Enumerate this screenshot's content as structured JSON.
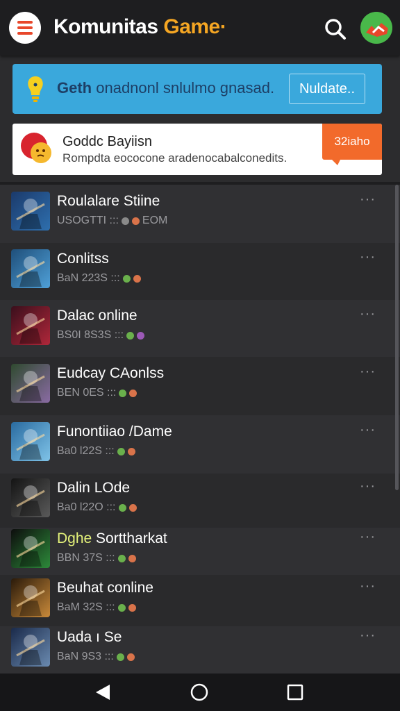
{
  "header": {
    "title_main": "Komunitas ",
    "title_accent": "Game·",
    "menu_icon": "hamburger-menu-icon",
    "search_icon": "search-icon",
    "avatar_icon": "user-avatar-icon"
  },
  "banner": {
    "text_bold": "Geth",
    "text_rest": " onadnonl snlulmo gnasad.",
    "button_label": "Nuldate..",
    "icon": "lightbulb-icon",
    "color": "#3aa8dc"
  },
  "notice": {
    "title": "Goddc Bayiisn",
    "subtitle": "Rompdta eococone aradenocabalconedits.",
    "tag_label": "32iaho",
    "icon": "emoji-face-icon",
    "tag_color": "#f26a2b"
  },
  "games": [
    {
      "name": "Roulalare Stiine",
      "meta": "USOGTTI ::: ",
      "meta_tail": " EOM",
      "dot1": "#8a8a8a",
      "dot2": "#d9734a",
      "thumb": [
        "#1b3a6b",
        "#2e6fae"
      ]
    },
    {
      "name": "Conlitss",
      "meta": "BaN 223S ::: ",
      "meta_tail": "",
      "dot1": "#6ab04c",
      "dot2": "#d9734a",
      "thumb": [
        "#1f4f7a",
        "#4fa0d8"
      ]
    },
    {
      "name": "Dalac online",
      "meta": "BS0I 8S3S ::: ",
      "meta_tail": "",
      "dot1": "#6ab04c",
      "dot2": "#9b59b6",
      "thumb": [
        "#3a0f1c",
        "#b0273a"
      ]
    },
    {
      "name": "Eudcay CAonlss",
      "meta": "BEN 0ES ::: ",
      "meta_tail": "",
      "dot1": "#6ab04c",
      "dot2": "#d9734a",
      "thumb": [
        "#2f4a2f",
        "#8a6ba3"
      ]
    },
    {
      "name": "Funontiiao /Dame",
      "meta": "Ba0 l22S ::: ",
      "meta_tail": "",
      "dot1": "#6ab04c",
      "dot2": "#d9734a",
      "thumb": [
        "#2a6ba0",
        "#7fc3e8"
      ]
    },
    {
      "name": "Dalin LOde",
      "meta": "Ba0 l22O ::: ",
      "meta_tail": "",
      "dot1": "#6ab04c",
      "dot2": "#d9734a",
      "thumb": [
        "#141414",
        "#5a5a5a"
      ]
    },
    {
      "name": "Dghe Sorttharkat",
      "meta": "BBN 37S ::: ",
      "meta_tail": "",
      "dot1": "#6ab04c",
      "dot2": "#d9734a",
      "thumb": [
        "#0d0d0d",
        "#2d8a3a"
      ],
      "accent": "#e4f27a"
    },
    {
      "name": "Beuhat conline",
      "meta": "BaM 32S ::: ",
      "meta_tail": "",
      "dot1": "#6ab04c",
      "dot2": "#d9734a",
      "thumb": [
        "#2a1a0a",
        "#c98a3a"
      ]
    },
    {
      "name": "Uada ı Se",
      "meta": "BaN 9S3 ::: ",
      "meta_tail": "",
      "dot1": "#6ab04c",
      "dot2": "#d9734a",
      "thumb": [
        "#1a2a4a",
        "#6a8ab0"
      ]
    }
  ],
  "more_label": "···",
  "navbar": {
    "back_icon": "back-triangle-icon",
    "home_icon": "home-circle-icon",
    "recent_icon": "recent-apps-square-icon"
  }
}
